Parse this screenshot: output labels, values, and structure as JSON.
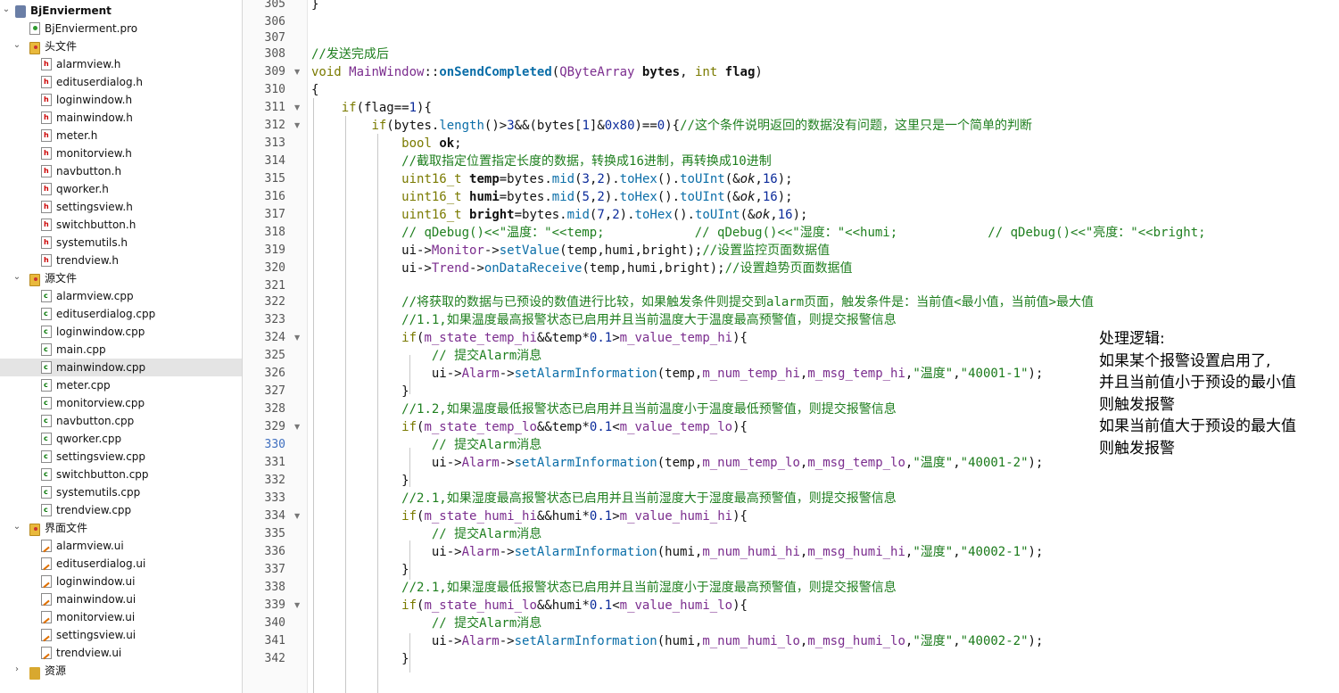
{
  "project_tree": {
    "project": "BjEnvierment",
    "pro_file": "BjEnvierment.pro",
    "headers_label": "头文件",
    "headers": [
      "alarmview.h",
      "edituserdialog.h",
      "loginwindow.h",
      "mainwindow.h",
      "meter.h",
      "monitorview.h",
      "navbutton.h",
      "qworker.h",
      "settingsview.h",
      "switchbutton.h",
      "systemutils.h",
      "trendview.h"
    ],
    "sources_label": "源文件",
    "sources": [
      "alarmview.cpp",
      "edituserdialog.cpp",
      "loginwindow.cpp",
      "main.cpp",
      "mainwindow.cpp",
      "meter.cpp",
      "monitorview.cpp",
      "navbutton.cpp",
      "qworker.cpp",
      "settingsview.cpp",
      "switchbutton.cpp",
      "systemutils.cpp",
      "trendview.cpp"
    ],
    "selected": "mainwindow.cpp",
    "forms_label": "界面文件",
    "forms": [
      "alarmview.ui",
      "edituserdialog.ui",
      "loginwindow.ui",
      "mainwindow.ui",
      "monitorview.ui",
      "settingsview.ui",
      "trendview.ui"
    ],
    "resources_label": "资源"
  },
  "editor": {
    "current_line": "330",
    "lines": [
      {
        "n": "305",
        "t": [
          [
            "}"
          ]
        ]
      },
      {
        "n": "306",
        "t": []
      },
      {
        "n": "307",
        "t": []
      },
      {
        "n": "308",
        "t": [
          [
            "//发送完成后",
            "cm"
          ]
        ]
      },
      {
        "n": "309",
        "fold": true,
        "t": [
          [
            "void",
            "kw"
          ],
          [
            " "
          ],
          [
            "MainWindow",
            "cls"
          ],
          [
            "::"
          ],
          [
            "onSendCompleted",
            "fnb"
          ],
          [
            "("
          ],
          [
            "QByteArray",
            "cls"
          ],
          [
            " "
          ],
          [
            "bytes",
            "b"
          ],
          [
            ", "
          ],
          [
            "int",
            "kw"
          ],
          [
            " "
          ],
          [
            "flag",
            "b"
          ],
          [
            ")"
          ]
        ]
      },
      {
        "n": "310",
        "t": [
          [
            "{"
          ]
        ]
      },
      {
        "n": "311",
        "fold": true,
        "t": [
          [
            "    "
          ],
          [
            "if",
            "kw"
          ],
          [
            "(flag=="
          ],
          [
            "1",
            "num"
          ],
          [
            "){"
          ]
        ]
      },
      {
        "n": "312",
        "fold": true,
        "t": [
          [
            "        "
          ],
          [
            "if",
            "kw"
          ],
          [
            "(bytes."
          ],
          [
            "length",
            "fn"
          ],
          [
            "()>"
          ],
          [
            "3",
            "num"
          ],
          [
            "&&(bytes["
          ],
          [
            "1",
            "num"
          ],
          [
            "]&"
          ],
          [
            "0x80",
            "num"
          ],
          [
            ")=="
          ],
          [
            "0",
            "num"
          ],
          [
            "){"
          ],
          [
            "//这个条件说明返回的数据没有问题，这里只是一个简单的判断",
            "cm"
          ]
        ]
      },
      {
        "n": "313",
        "t": [
          [
            "            "
          ],
          [
            "bool",
            "kw"
          ],
          [
            " "
          ],
          [
            "ok",
            "b"
          ],
          [
            ";"
          ]
        ]
      },
      {
        "n": "314",
        "t": [
          [
            "            "
          ],
          [
            "//截取指定位置指定长度的数据，转换成16进制，再转换成10进制",
            "cm"
          ]
        ]
      },
      {
        "n": "315",
        "t": [
          [
            "            "
          ],
          [
            "uint16_t",
            "ty"
          ],
          [
            " "
          ],
          [
            "temp",
            "b"
          ],
          [
            "=bytes."
          ],
          [
            "mid",
            "fn"
          ],
          [
            "("
          ],
          [
            "3",
            "num"
          ],
          [
            ","
          ],
          [
            "2",
            "num"
          ],
          [
            ")."
          ],
          [
            "toHex",
            "fn"
          ],
          [
            "()."
          ],
          [
            "toUInt",
            "fn"
          ],
          [
            "(&"
          ],
          [
            "ok",
            "it"
          ],
          [
            ","
          ],
          [
            "16",
            "num"
          ],
          [
            ");"
          ]
        ]
      },
      {
        "n": "316",
        "t": [
          [
            "            "
          ],
          [
            "uint16_t",
            "ty"
          ],
          [
            " "
          ],
          [
            "humi",
            "b"
          ],
          [
            "=bytes."
          ],
          [
            "mid",
            "fn"
          ],
          [
            "("
          ],
          [
            "5",
            "num"
          ],
          [
            ","
          ],
          [
            "2",
            "num"
          ],
          [
            ")."
          ],
          [
            "toHex",
            "fn"
          ],
          [
            "()."
          ],
          [
            "toUInt",
            "fn"
          ],
          [
            "(&"
          ],
          [
            "ok",
            "it"
          ],
          [
            ","
          ],
          [
            "16",
            "num"
          ],
          [
            ");"
          ]
        ]
      },
      {
        "n": "317",
        "t": [
          [
            "            "
          ],
          [
            "uint16_t",
            "ty"
          ],
          [
            " "
          ],
          [
            "bright",
            "b"
          ],
          [
            "=bytes."
          ],
          [
            "mid",
            "fn"
          ],
          [
            "("
          ],
          [
            "7",
            "num"
          ],
          [
            ","
          ],
          [
            "2",
            "num"
          ],
          [
            ")."
          ],
          [
            "toHex",
            "fn"
          ],
          [
            "()."
          ],
          [
            "toUInt",
            "fn"
          ],
          [
            "(&"
          ],
          [
            "ok",
            "it"
          ],
          [
            ","
          ],
          [
            "16",
            "num"
          ],
          [
            ");"
          ]
        ]
      },
      {
        "n": "318",
        "t": [
          [
            "            "
          ],
          [
            "// qDebug()<<\"温度：\"<<temp;            // qDebug()<<\"湿度：\"<<humi;            // qDebug()<<\"亮度：\"<<bright;",
            "cm"
          ]
        ]
      },
      {
        "n": "319",
        "t": [
          [
            "            ui->"
          ],
          [
            "Monitor",
            "cls"
          ],
          [
            "->"
          ],
          [
            "setValue",
            "fn"
          ],
          [
            "(temp,humi,bright);"
          ],
          [
            "//设置监控页面数据值",
            "cm"
          ]
        ]
      },
      {
        "n": "320",
        "t": [
          [
            "            ui->"
          ],
          [
            "Trend",
            "cls"
          ],
          [
            "->"
          ],
          [
            "onDataReceive",
            "fn"
          ],
          [
            "(temp,humi,bright);"
          ],
          [
            "//设置趋势页面数据值",
            "cm"
          ]
        ]
      },
      {
        "n": "321",
        "t": []
      },
      {
        "n": "322",
        "t": [
          [
            "            "
          ],
          [
            "//将获取的数据与已预设的数值进行比较，如果触发条件则提交到alarm页面，触发条件是：当前值<最小值，当前值>最大值",
            "cm"
          ]
        ]
      },
      {
        "n": "323",
        "t": [
          [
            "            "
          ],
          [
            "//1.1,如果温度最高报警状态已启用并且当前温度大于温度最高预警值，则提交报警信息",
            "cm"
          ]
        ]
      },
      {
        "n": "324",
        "fold": true,
        "t": [
          [
            "            "
          ],
          [
            "if",
            "kw"
          ],
          [
            "("
          ],
          [
            "m_state_temp_hi",
            "cls"
          ],
          [
            "&&temp*"
          ],
          [
            "0.1",
            "num"
          ],
          [
            ">"
          ],
          [
            "m_value_temp_hi",
            "cls"
          ],
          [
            "){"
          ]
        ]
      },
      {
        "n": "325",
        "t": [
          [
            "                "
          ],
          [
            "// 提交Alarm消息",
            "cm"
          ]
        ]
      },
      {
        "n": "326",
        "t": [
          [
            "                ui->"
          ],
          [
            "Alarm",
            "cls"
          ],
          [
            "->"
          ],
          [
            "setAlarmInformation",
            "fn"
          ],
          [
            "(temp,"
          ],
          [
            "m_num_temp_hi",
            "cls"
          ],
          [
            ","
          ],
          [
            "m_msg_temp_hi",
            "cls"
          ],
          [
            ","
          ],
          [
            "\"温度\"",
            "str"
          ],
          [
            ","
          ],
          [
            "\"40001-1\"",
            "str"
          ],
          [
            ");"
          ]
        ]
      },
      {
        "n": "327",
        "t": [
          [
            "            }"
          ]
        ]
      },
      {
        "n": "328",
        "t": [
          [
            "            "
          ],
          [
            "//1.2,如果温度最低报警状态已启用并且当前温度小于温度最低预警值，则提交报警信息",
            "cm"
          ]
        ]
      },
      {
        "n": "329",
        "fold": true,
        "t": [
          [
            "            "
          ],
          [
            "if",
            "kw"
          ],
          [
            "("
          ],
          [
            "m_state_temp_lo",
            "cls"
          ],
          [
            "&&temp*"
          ],
          [
            "0.1",
            "num"
          ],
          [
            "<"
          ],
          [
            "m_value_temp_lo",
            "cls"
          ],
          [
            "){"
          ]
        ]
      },
      {
        "n": "330",
        "t": [
          [
            "                "
          ],
          [
            "// 提交Alarm消息",
            "cm"
          ]
        ]
      },
      {
        "n": "331",
        "t": [
          [
            "                ui->"
          ],
          [
            "Alarm",
            "cls"
          ],
          [
            "->"
          ],
          [
            "setAlarmInformation",
            "fn"
          ],
          [
            "(temp,"
          ],
          [
            "m_num_temp_lo",
            "cls"
          ],
          [
            ","
          ],
          [
            "m_msg_temp_lo",
            "cls"
          ],
          [
            ","
          ],
          [
            "\"温度\"",
            "str"
          ],
          [
            ","
          ],
          [
            "\"40001-2\"",
            "str"
          ],
          [
            ");"
          ]
        ]
      },
      {
        "n": "332",
        "t": [
          [
            "            }"
          ]
        ]
      },
      {
        "n": "333",
        "t": [
          [
            "            "
          ],
          [
            "//2.1,如果湿度最高报警状态已启用并且当前湿度大于湿度最高预警值，则提交报警信息",
            "cm"
          ]
        ]
      },
      {
        "n": "334",
        "fold": true,
        "t": [
          [
            "            "
          ],
          [
            "if",
            "kw"
          ],
          [
            "("
          ],
          [
            "m_state_humi_hi",
            "cls"
          ],
          [
            "&&humi*"
          ],
          [
            "0.1",
            "num"
          ],
          [
            ">"
          ],
          [
            "m_value_humi_hi",
            "cls"
          ],
          [
            "){"
          ]
        ]
      },
      {
        "n": "335",
        "t": [
          [
            "                "
          ],
          [
            "// 提交Alarm消息",
            "cm"
          ]
        ]
      },
      {
        "n": "336",
        "t": [
          [
            "                ui->"
          ],
          [
            "Alarm",
            "cls"
          ],
          [
            "->"
          ],
          [
            "setAlarmInformation",
            "fn"
          ],
          [
            "(humi,"
          ],
          [
            "m_num_humi_hi",
            "cls"
          ],
          [
            ","
          ],
          [
            "m_msg_humi_hi",
            "cls"
          ],
          [
            ","
          ],
          [
            "\"湿度\"",
            "str"
          ],
          [
            ","
          ],
          [
            "\"40002-1\"",
            "str"
          ],
          [
            ");"
          ]
        ]
      },
      {
        "n": "337",
        "t": [
          [
            "            }"
          ]
        ]
      },
      {
        "n": "338",
        "t": [
          [
            "            "
          ],
          [
            "//2.1,如果湿度最低报警状态已启用并且当前湿度小于湿度最高预警值，则提交报警信息",
            "cm"
          ]
        ]
      },
      {
        "n": "339",
        "fold": true,
        "t": [
          [
            "            "
          ],
          [
            "if",
            "kw"
          ],
          [
            "("
          ],
          [
            "m_state_humi_lo",
            "cls"
          ],
          [
            "&&humi*"
          ],
          [
            "0.1",
            "num"
          ],
          [
            "<"
          ],
          [
            "m_value_humi_lo",
            "cls"
          ],
          [
            "){"
          ]
        ]
      },
      {
        "n": "340",
        "t": [
          [
            "                "
          ],
          [
            "// 提交Alarm消息",
            "cm"
          ]
        ]
      },
      {
        "n": "341",
        "t": [
          [
            "                ui->"
          ],
          [
            "Alarm",
            "cls"
          ],
          [
            "->"
          ],
          [
            "setAlarmInformation",
            "fn"
          ],
          [
            "(humi,"
          ],
          [
            "m_num_humi_lo",
            "cls"
          ],
          [
            ","
          ],
          [
            "m_msg_humi_lo",
            "cls"
          ],
          [
            ","
          ],
          [
            "\"湿度\"",
            "str"
          ],
          [
            ","
          ],
          [
            "\"40002-2\"",
            "str"
          ],
          [
            ");"
          ]
        ]
      },
      {
        "n": "342",
        "t": [
          [
            "            }"
          ]
        ]
      }
    ]
  },
  "note": {
    "lines": [
      "处理逻辑:",
      "如果某个报警设置启用了,",
      "并且当前值小于预设的最小值",
      "则触发报警",
      "如果当前值大于预设的最大值",
      "则触发报警"
    ]
  }
}
